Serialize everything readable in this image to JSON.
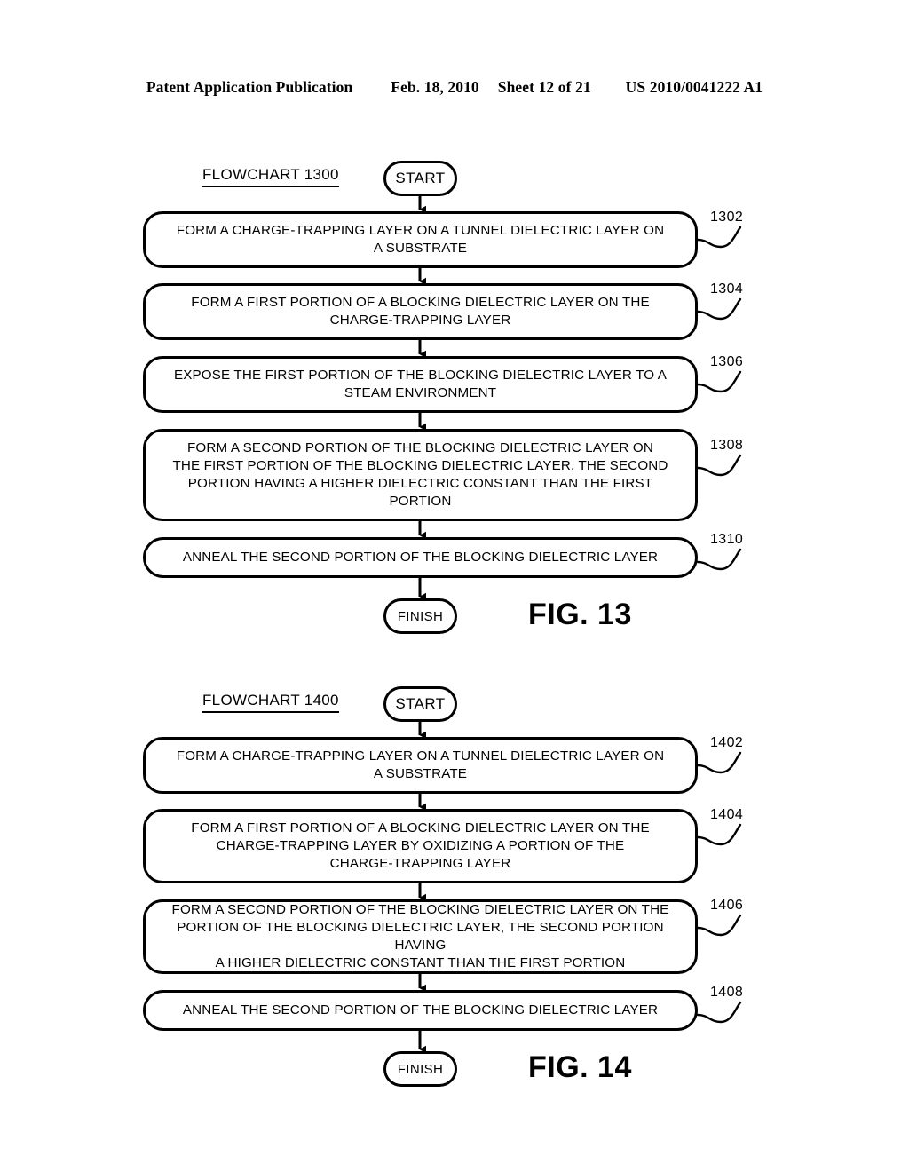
{
  "header": {
    "publication": "Patent Application Publication",
    "date": "Feb. 18, 2010",
    "sheet": "Sheet 12 of 21",
    "patent_number": "US 2010/0041222 A1"
  },
  "figures": [
    {
      "caption": "FIG. 13",
      "chart_title": "FLOWCHART 1300",
      "start_label": "START",
      "finish_label": "FINISH",
      "steps": [
        {
          "ref": "1302",
          "text": "FORM A CHARGE-TRAPPING LAYER ON A TUNNEL DIELECTRIC LAYER ON\nA SUBSTRATE"
        },
        {
          "ref": "1304",
          "text": "FORM A FIRST PORTION OF A BLOCKING DIELECTRIC LAYER ON THE\nCHARGE-TRAPPING LAYER"
        },
        {
          "ref": "1306",
          "text": "EXPOSE THE FIRST PORTION OF THE BLOCKING DIELECTRIC LAYER TO A\nSTEAM ENVIRONMENT"
        },
        {
          "ref": "1308",
          "text": "FORM A SECOND PORTION OF THE BLOCKING DIELECTRIC LAYER ON\nTHE FIRST PORTION OF THE BLOCKING DIELECTRIC LAYER, THE SECOND\nPORTION HAVING A HIGHER DIELECTRIC CONSTANT THAN THE FIRST\nPORTION"
        },
        {
          "ref": "1310",
          "text": "ANNEAL THE SECOND PORTION OF THE BLOCKING DIELECTRIC LAYER"
        }
      ]
    },
    {
      "caption": "FIG. 14",
      "chart_title": "FLOWCHART 1400",
      "start_label": "START",
      "finish_label": "FINISH",
      "steps": [
        {
          "ref": "1402",
          "text": "FORM A CHARGE-TRAPPING LAYER ON A TUNNEL DIELECTRIC LAYER ON\nA SUBSTRATE"
        },
        {
          "ref": "1404",
          "text": "FORM A FIRST PORTION OF A BLOCKING DIELECTRIC LAYER ON THE\nCHARGE-TRAPPING LAYER BY OXIDIZING A PORTION OF THE\nCHARGE-TRAPPING LAYER"
        },
        {
          "ref": "1406",
          "text": "FORM A SECOND PORTION OF THE BLOCKING DIELECTRIC LAYER ON THE\nPORTION OF THE BLOCKING DIELECTRIC LAYER, THE SECOND PORTION HAVING\nA HIGHER DIELECTRIC CONSTANT THAN THE FIRST PORTION"
        },
        {
          "ref": "1408",
          "text": "ANNEAL THE SECOND PORTION OF THE BLOCKING DIELECTRIC LAYER"
        }
      ]
    }
  ],
  "colors": {
    "ink": "#000000",
    "paper": "#ffffff"
  }
}
